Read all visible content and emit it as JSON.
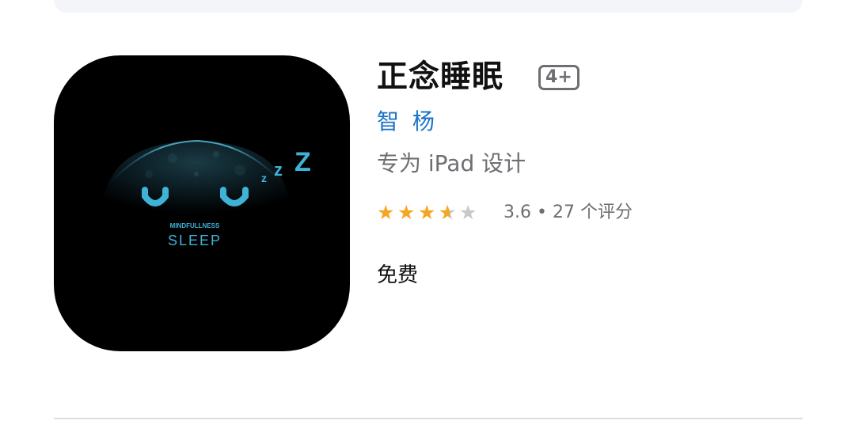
{
  "app": {
    "title": "正念睡眠",
    "age_rating": "4+",
    "developer": "智 杨",
    "subtitle": "专为 iPad 设计",
    "rating_value": 3.6,
    "rating_text": "3.6 • 27 个评分",
    "price": "免费"
  },
  "icon": {
    "brand_small": "MINDFULLNESS",
    "brand_large": "SLEEP",
    "zzz": [
      "z",
      "z",
      "Z"
    ],
    "accent_color": "#3fb2d6"
  },
  "colors": {
    "developer_link": "#1a73c7",
    "star_filled": "#f5a623",
    "star_empty": "#c7c7cc"
  }
}
